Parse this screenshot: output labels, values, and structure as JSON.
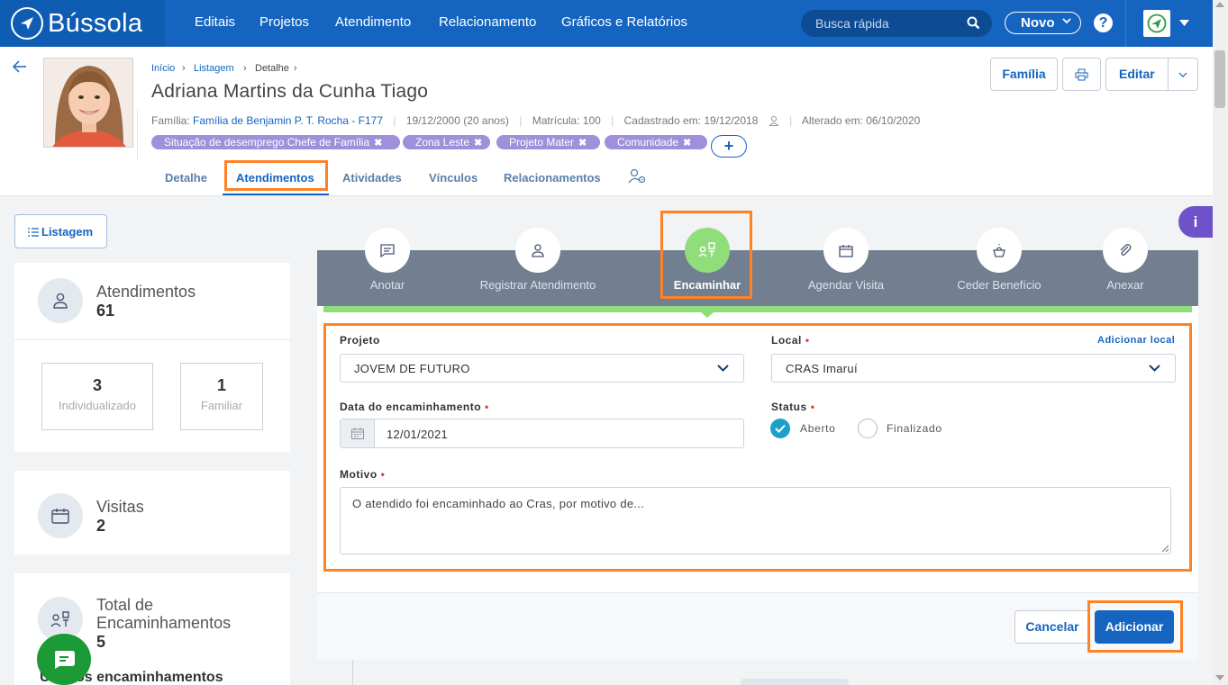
{
  "app": {
    "name": "Bússola"
  },
  "nav": {
    "items": [
      "Editais",
      "Projetos",
      "Atendimento",
      "Relacionamento",
      "Gráficos e Relatórios"
    ],
    "search_placeholder": "Busca rápida",
    "novo_label": "Novo",
    "help_label": "?"
  },
  "breadcrumb": {
    "items": [
      "Início",
      "Listagem",
      "Detalhe"
    ]
  },
  "person": {
    "name": "Adriana Martins da Cunha Tiago",
    "familia_label": "Família:",
    "familia_link": "Família de Benjamin P. T. Rocha - F177",
    "birth": "19/12/2000 (20 anos)",
    "matricula": "Matrícula: 100",
    "cadastrado": "Cadastrado em: 19/12/2018",
    "alterado": "Alterado em: 06/10/2020",
    "tags": [
      "Situação de desemprego Chefe de Família",
      "Zona Leste",
      "Projeto Mater",
      "Comunidade"
    ],
    "tag_remove": "✖",
    "add_tag": "+"
  },
  "header_actions": {
    "familia": "Família",
    "editar": "Editar"
  },
  "tabs": [
    "Detalhe",
    "Atendimentos",
    "Atividades",
    "Vínculos",
    "Relacionamentos"
  ],
  "sidebar": {
    "listagem": "Listagem",
    "atendimentos": {
      "title": "Atendimentos",
      "value": "61",
      "individual": "3",
      "individual_label": "Individualizado",
      "familiar": "1",
      "familiar_label": "Familiar"
    },
    "visitas": {
      "title": "Visitas",
      "value": "2"
    },
    "encaminhamentos": {
      "title_line1": "Total de",
      "title_line2": "Encaminhamentos",
      "value": "5"
    },
    "ultimos": "Últimos encaminhamentos"
  },
  "actions": [
    "Anotar",
    "Registrar Atendimento",
    "Encaminhar",
    "Agendar Visita",
    "Ceder Benefício",
    "Anexar"
  ],
  "form": {
    "projeto_label": "Projeto",
    "projeto_value": "JOVEM DE FUTURO",
    "local_label": "Local",
    "local_value": "CRAS Imaruí",
    "adicionar_local": "Adicionar local",
    "data_label": "Data do encaminhamento",
    "data_value": "12/01/2021",
    "status_label": "Status",
    "status_options": [
      "Aberto",
      "Finalizado"
    ],
    "status_selected": "Aberto",
    "motivo_label": "Motivo",
    "motivo_value": "O atendido foi encaminhado ao Cras, por motivo de...",
    "required_marker": "•"
  },
  "footer": {
    "cancel": "Cancelar",
    "submit": "Adicionar"
  },
  "info_label": "i",
  "colors": {
    "primary": "#1565c0",
    "active_action": "#8fde7b",
    "highlight": "#ff8225",
    "tag": "#a08fdb"
  }
}
